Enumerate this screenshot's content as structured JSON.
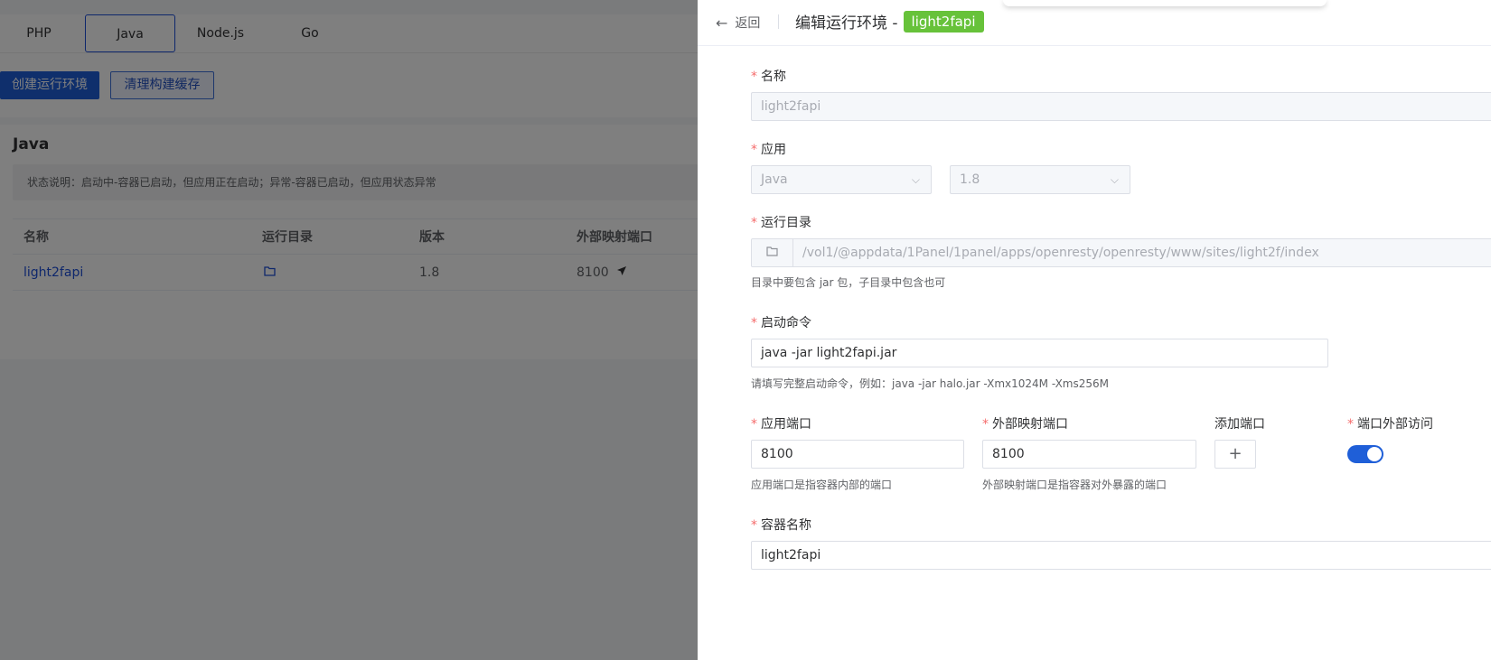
{
  "tabs": [
    "PHP",
    "Java",
    "Node.js",
    "Go"
  ],
  "toolbar": {
    "create_label": "创建运行环境",
    "clean_label": "清理构建缓存"
  },
  "section": {
    "title": "Java",
    "status_note": "状态说明：启动中-容器已启动，但应用正在启动；异常-容器已启动，但应用状态异常"
  },
  "table": {
    "headers": {
      "name": "名称",
      "dir": "运行目录",
      "version": "版本",
      "port": "外部映射端口"
    },
    "row": {
      "name": "light2fapi",
      "version": "1.8",
      "port": "8100"
    }
  },
  "drawer": {
    "back_label": "返回",
    "title": "编辑运行环境 -",
    "tag": "light2fapi",
    "form": {
      "name_label": "名称",
      "name_value": "light2fapi",
      "app_label": "应用",
      "app_value": "Java",
      "version_value": "1.8",
      "dir_label": "运行目录",
      "dir_value": "/vol1/@appdata/1Panel/1panel/apps/openresty/openresty/www/sites/light2f/index",
      "dir_hint": "目录中要包含 jar 包，子目录中包含也可",
      "cmd_label": "启动命令",
      "cmd_value": "java -jar light2fapi.jar",
      "cmd_hint": "请填写完整启动命令，例如：java -jar halo.jar -Xmx1024M -Xms256M",
      "app_port_label": "应用端口",
      "app_port_value": "8100",
      "app_port_hint": "应用端口是指容器内部的端口",
      "ext_port_label": "外部映射端口",
      "ext_port_value": "8100",
      "ext_port_hint": "外部映射端口是指容器对外暴露的端口",
      "add_port_label": "添加端口",
      "external_access_label": "端口外部访问",
      "external_access_enabled": true,
      "container_label": "容器名称",
      "container_value": "light2fapi"
    }
  },
  "colors": {
    "primary": "#1f5fd8",
    "tag_green": "#67c23a",
    "required": "#f56c6c"
  }
}
